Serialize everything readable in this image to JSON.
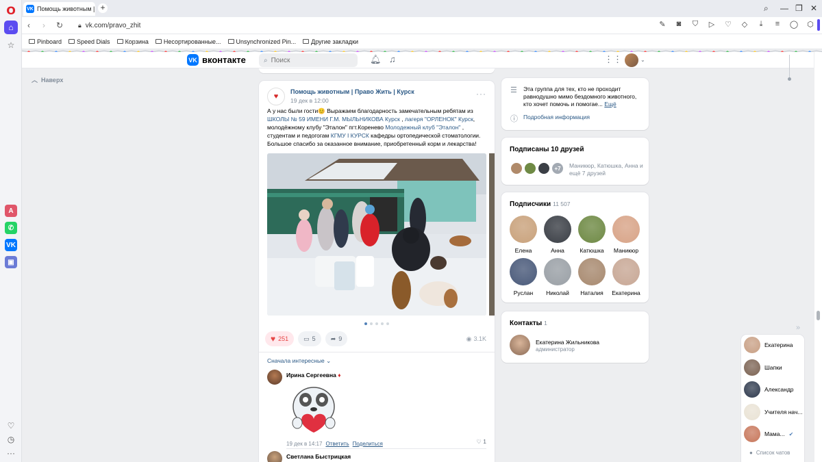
{
  "browser": {
    "tab_title": "Помощь животным | Пра",
    "url": "vk.com/pravo_zhit",
    "bookmarks": [
      "Pinboard",
      "Speed Dials",
      "Корзина",
      "Несортированные...",
      "Unsynchronized Pin...",
      "Другие закладки"
    ]
  },
  "vk": {
    "logo_text": "вконтакте",
    "search_placeholder": "Поиск",
    "back_to_top": "Наверх"
  },
  "post": {
    "author": "Помощь животным | Право Жить | Курск",
    "date": "19 дек в 12:00",
    "text_1": "А у нас были гости",
    "text_2": " Выражаем благодарность замечательным ребятам из ",
    "link_school": "ШКОЛЫ № 59 ИМЕНИ Г.М. МЫЛЬНИКОВА Курск",
    "text_3": " , ",
    "link_camp": "лагеря \"ОРЛЕНОК\" Курск",
    "text_4": ", молодёжному клубу \"Эталон\" пгт.Коренево ",
    "link_club": "Молодежный клуб \"Эталон\"",
    "text_5": " , студентам и педогогам ",
    "link_uni": "КГМУ І КУРСК",
    "text_6": " кафедры ортопедической стоматологии. Большое спасибо за оказанное внимание, приобретенный корм и лекарства!",
    "likes": "251",
    "comments": "5",
    "shares": "9",
    "views": "3.1K",
    "sort_label": "Сначала интересные"
  },
  "comments": [
    {
      "name": "Ирина Сергеевна",
      "date": "19 дек в 14:17",
      "reply": "Ответить",
      "share": "Поделиться",
      "likes": "1"
    },
    {
      "name": "Светлана Быстрицкая"
    }
  ],
  "about": {
    "text": "Эта группа для тех, кто не проходит равнодушно мимо бездомного животного, кто хочет помочь и помогае...",
    "more": "Ещё",
    "details": "Подробная информация"
  },
  "friends": {
    "title": "Подписаны 10 друзей",
    "extra": "+7",
    "names": "Маникюр, Катюшка, Анна и ещё 7 друзей"
  },
  "subscribers": {
    "title": "Подписчики",
    "count": "11 507",
    "list": [
      {
        "name": "Елена",
        "color": "#c9a27c"
      },
      {
        "name": "Анна",
        "color": "#3b3f46"
      },
      {
        "name": "Катюшка",
        "color": "#6f8a45"
      },
      {
        "name": "Маникюр",
        "color": "#d8a488"
      },
      {
        "name": "Руслан",
        "color": "#4a5a7a"
      },
      {
        "name": "Николай",
        "color": "#9aa0a6"
      },
      {
        "name": "Наталия",
        "color": "#a88a70"
      },
      {
        "name": "Екатерина",
        "color": "#c8a896"
      }
    ]
  },
  "contacts": {
    "title": "Контакты",
    "count": "1",
    "name": "Екатерина Жильникова",
    "role": "администратор"
  },
  "chats": {
    "items": [
      {
        "name": "Екатерина",
        "color": "#c89f84"
      },
      {
        "name": "Шапки",
        "color": "#7b6252"
      },
      {
        "name": "Александр",
        "color": "#2f3a4e"
      },
      {
        "name": "Учителя нач...",
        "color": "#e9e2d4"
      },
      {
        "name": "Мама...",
        "color": "#c7765a"
      }
    ],
    "list_label": "Список чатов"
  }
}
